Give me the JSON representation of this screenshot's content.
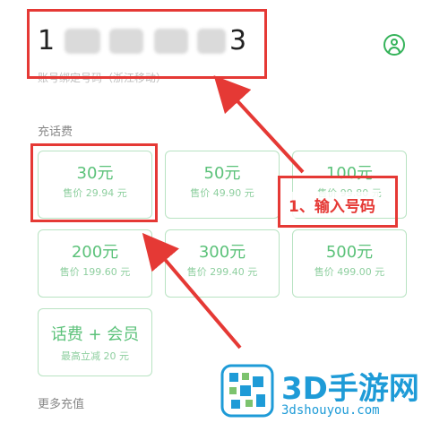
{
  "phone": {
    "prefix": "1",
    "suffix": "3"
  },
  "carrier_label": "账号绑定号码（浙江移动）",
  "avatar_icon": "user-circle-icon",
  "section_recharge": "充话费",
  "cards": [
    {
      "amount": "30元",
      "price": "售价 29.94 元"
    },
    {
      "amount": "50元",
      "price": "售价 49.90 元"
    },
    {
      "amount": "100元",
      "price": "售价 99.80 元"
    },
    {
      "amount": "200元",
      "price": "售价 199.60 元"
    },
    {
      "amount": "300元",
      "price": "售价 299.40 元"
    },
    {
      "amount": "500元",
      "price": "售价 499.00 元"
    },
    {
      "amount": "话费 + 会员",
      "price": "最高立减 20 元"
    }
  ],
  "section_more": "更多充值",
  "annotation": "1、输入号码",
  "watermark": {
    "brand": "3D手游网",
    "url": "3dshouyou.com"
  },
  "colors": {
    "accent": "#35b35a",
    "highlight": "#e53935",
    "watermark": "#1e9bd7"
  }
}
